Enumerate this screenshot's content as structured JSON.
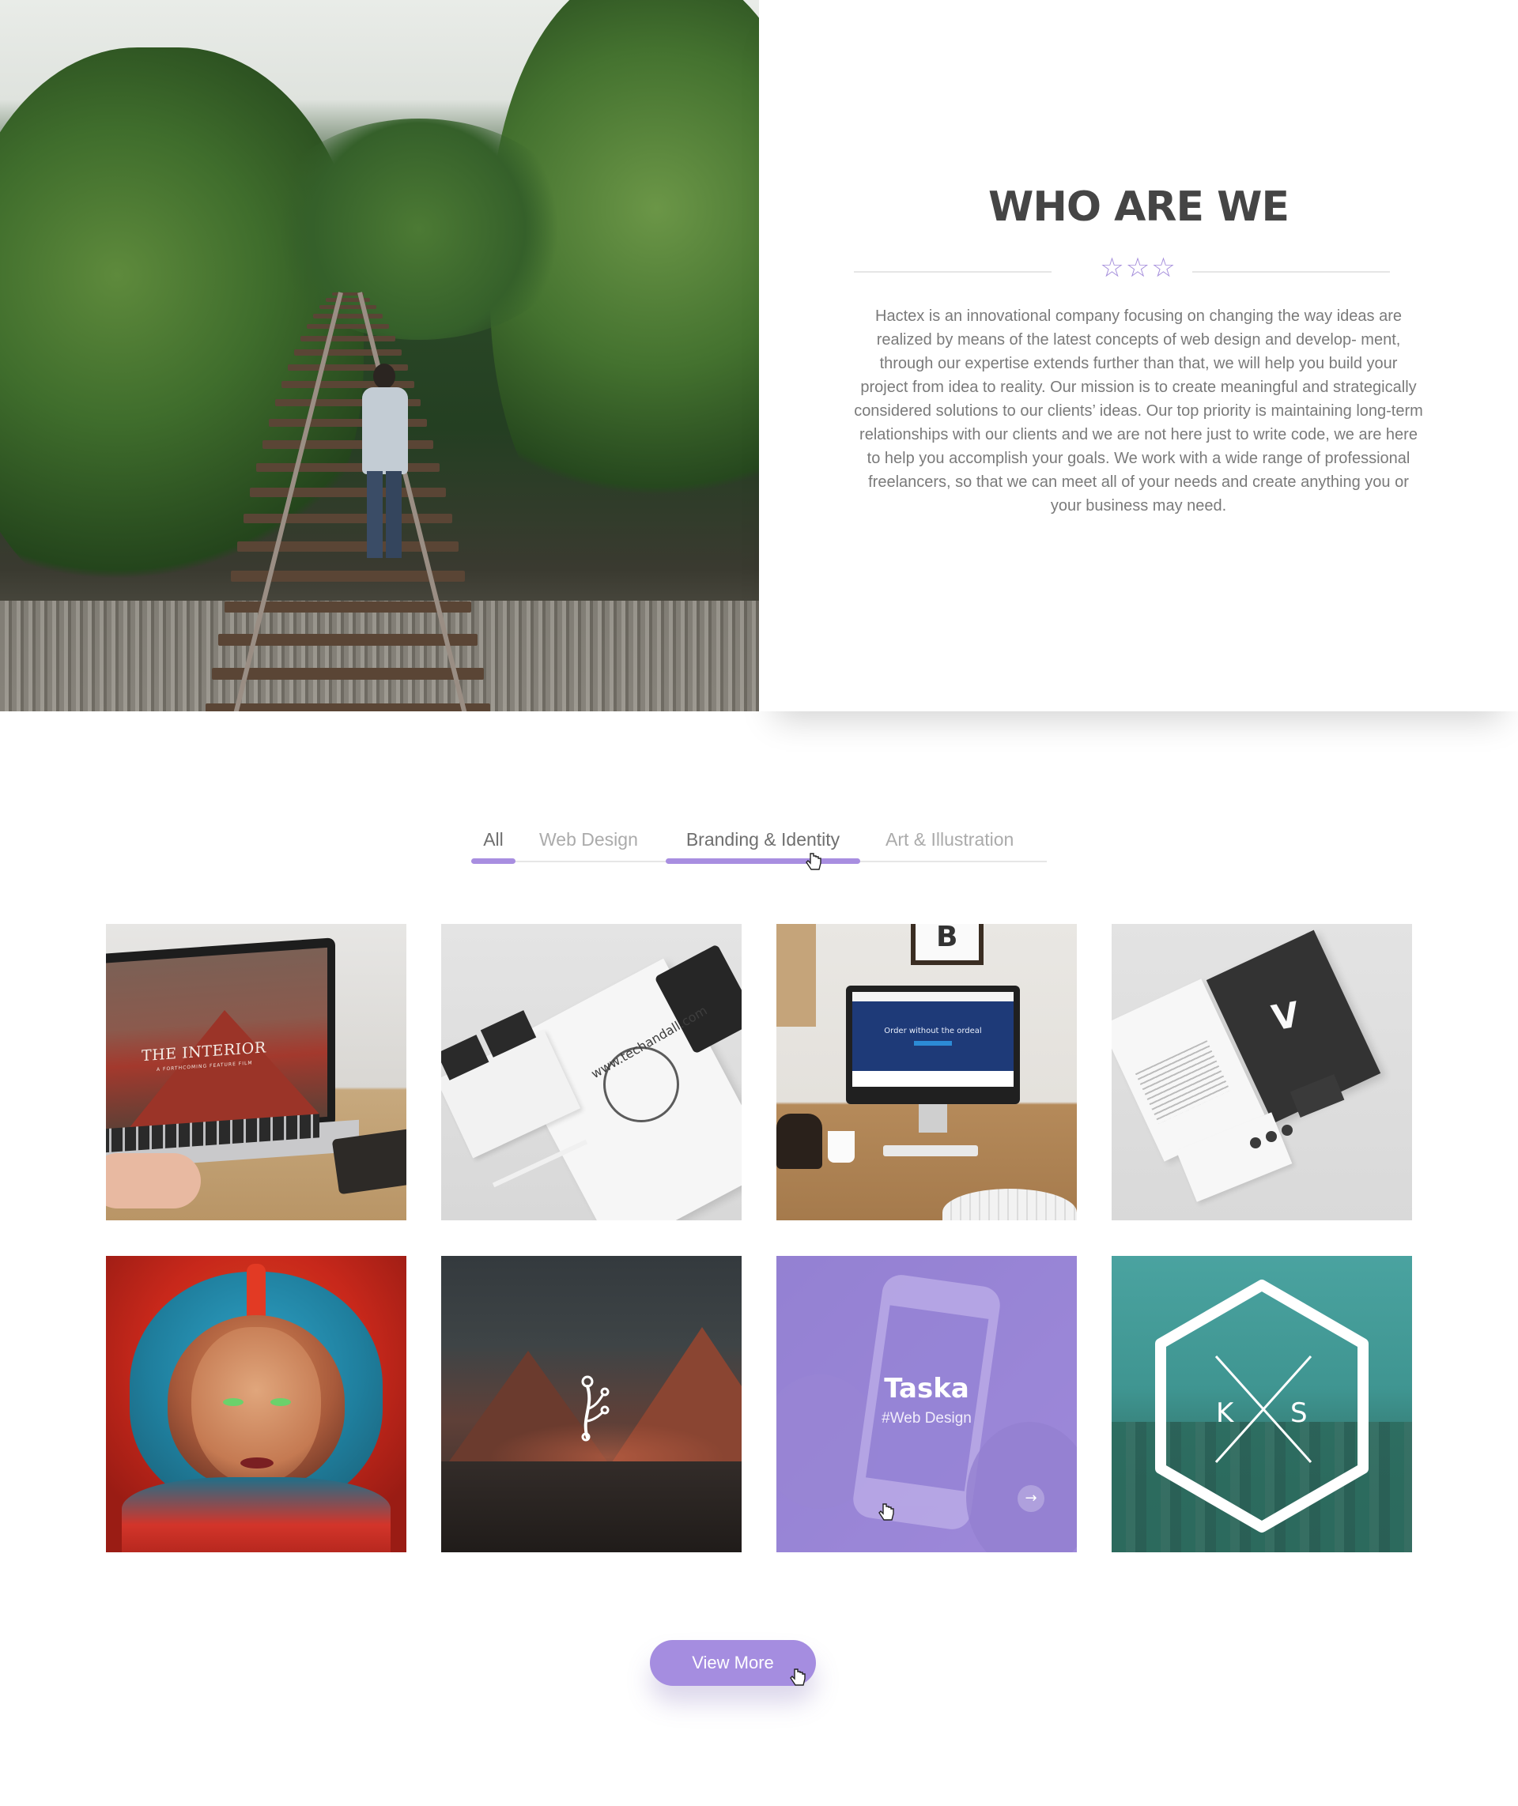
{
  "about": {
    "title": "WHO ARE WE",
    "stars": "☆☆☆",
    "paragraph": "Hactex is an innovational company focusing on changing the way ideas are realized by means of the latest concepts of web design and develop- ment, through our expertise extends further than that, we will help you build your project from idea to reality. Our mission is to create meaningful and strategically considered solutions to our clients’ ideas. Our top priority is maintaining long-term relationships with our clients and we are not here just to write code, we are here to help you accomplish your goals. We work with a wide range of professional freelancers, so that we can meet all of your needs and create anything you or your business may need."
  },
  "filters": {
    "tabs": [
      {
        "label": "All",
        "active": true
      },
      {
        "label": "Web Design",
        "active": false
      },
      {
        "label": "Branding & Identity",
        "active": true
      },
      {
        "label": "Art & Illustration",
        "active": false
      }
    ]
  },
  "portfolio": {
    "items": [
      {
        "name": "laptop-mockup",
        "screen_title": "THE INTERIOR",
        "screen_subtitle": "A FORTHCOMING FEATURE FILM"
      },
      {
        "name": "stationery-mockup",
        "seal_text": "www.techandall.com"
      },
      {
        "name": "desk-mockup",
        "frame_letter": "B",
        "screen_text": "Order without the ordeal"
      },
      {
        "name": "v-stationery-mockup",
        "mark": "V"
      },
      {
        "name": "helmet-illustration"
      },
      {
        "name": "dark-landscape"
      },
      {
        "name": "taska",
        "title": "Taska",
        "tag": "#Web Design"
      },
      {
        "name": "ks-hexagon-logo",
        "left_letter": "K",
        "right_letter": "S"
      }
    ]
  },
  "cta": {
    "view_more_label": "View More"
  },
  "colors": {
    "accent": "#a58de0",
    "heading": "#454545",
    "body_text": "#7a7a7a"
  }
}
